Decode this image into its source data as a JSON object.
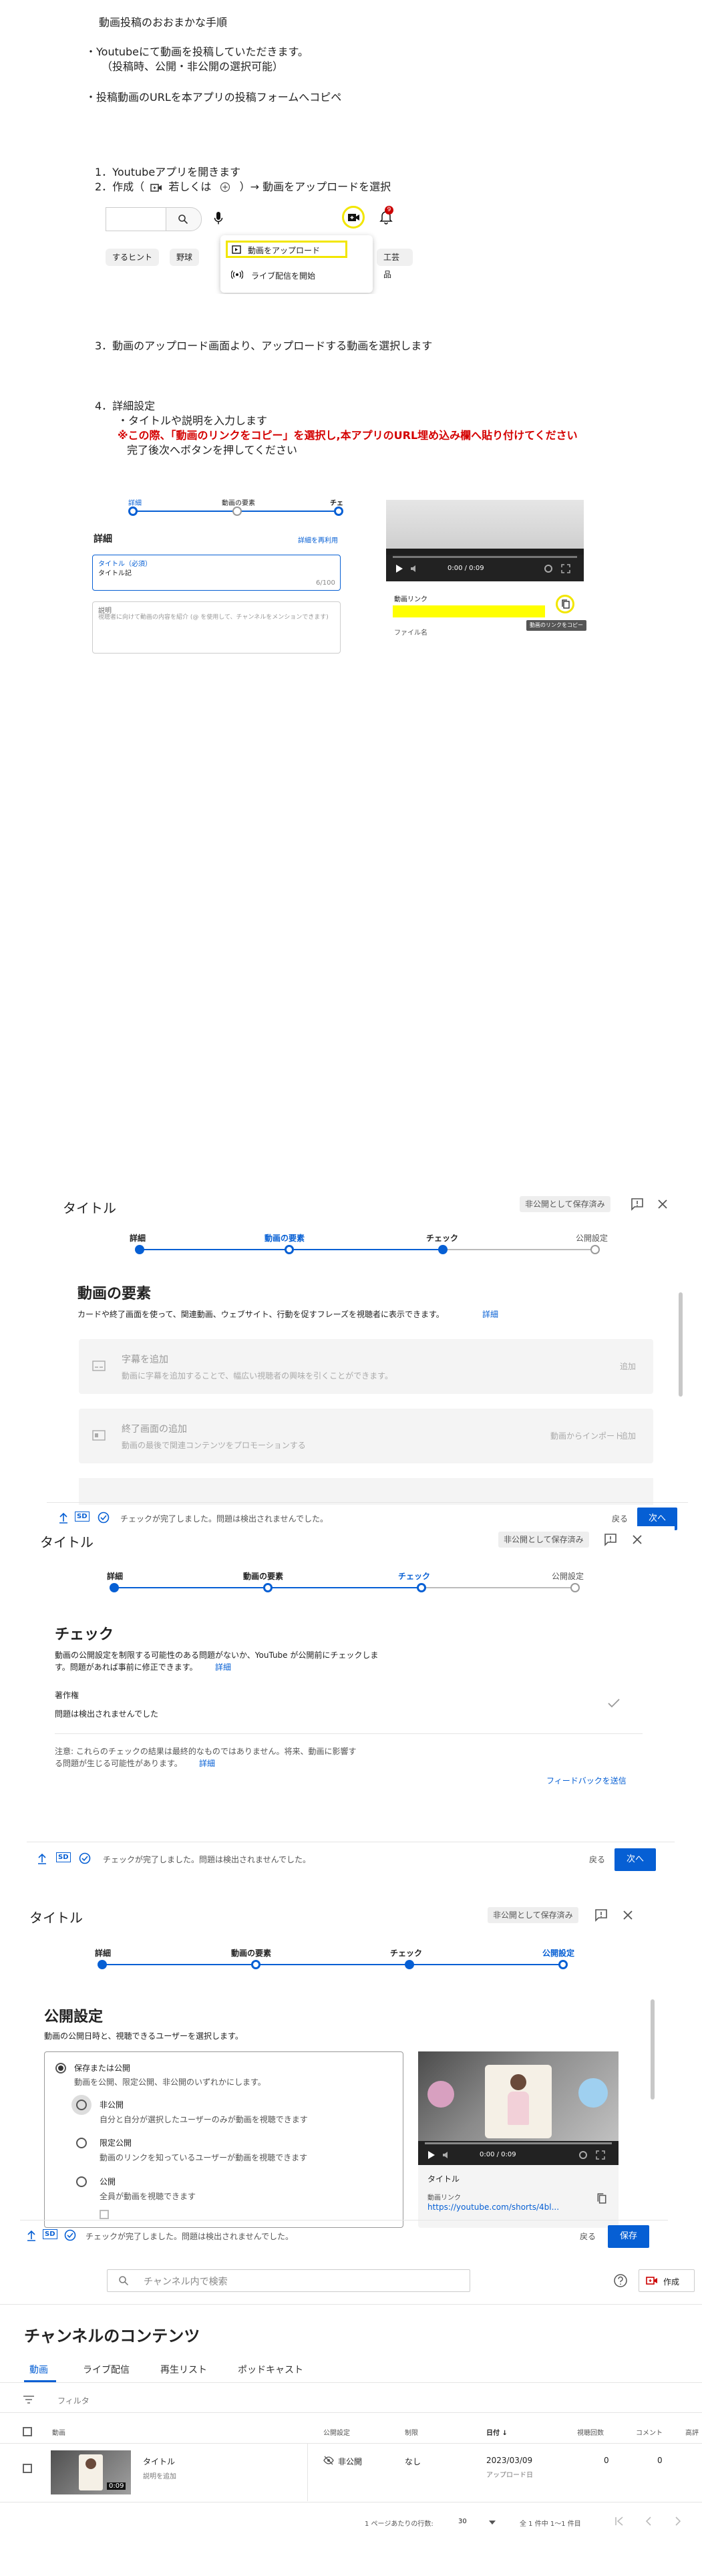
{
  "intro": {
    "heading": "動画投稿のおおまかな手順",
    "bullet1_line1": "・Youtubeにて動画を投稿していただきます。",
    "bullet1_line2": "（投稿時、公開・非公開の選択可能）",
    "bullet2": "・投稿動画のURLを本アプリの投稿フォームへコピペ"
  },
  "steps": {
    "s1": "1．Youtubeアプリを開きます",
    "s2_prefix": "2．作成（",
    "s2_mid": "若しくは",
    "s2_suffix": "）→ 動画をアップロードを選択",
    "s3": "3．動画のアップロード画面より、アップロードする動画を選択します",
    "s4": "4．詳細設定",
    "s4_a": "・タイトルや説明を入力します",
    "s4_warn": "※この際、「動画のリンクをコピー」を選択し,本アプリのURL埋め込み欄へ貼り付けてください",
    "s4_b": "完了後次へボタンを押してください"
  },
  "shot_create": {
    "menu_upload": "動画をアップロード",
    "menu_live": "ライブ配信を開始",
    "chip_hint": "するヒント",
    "chip_baseball": "野球",
    "chip_craft": "工芸品",
    "badge": "9"
  },
  "shot_details": {
    "step_details": "詳細",
    "step_elements": "動画の要素",
    "step_check": "チェ",
    "heading": "詳細",
    "reuse": "詳細を再利用",
    "title_label": "タイトル（必須）",
    "title_value": "タイトル記",
    "title_count": "6/100",
    "desc_label": "説明",
    "desc_placeholder": "視聴者に向けて動画の内容を紹介 (@ を使用して、チャンネルをメンションできます)",
    "time": "0:00 / 0:09",
    "link_label": "動画リンク",
    "file_label": "ファイル名",
    "tooltip": "動画のリンクをコピー"
  },
  "shot_elements": {
    "title": "タイトル",
    "saved_badge": "非公開として保存済み",
    "step1": "詳細",
    "step2": "動画の要素",
    "step3": "チェック",
    "step4": "公開設定",
    "heading": "動画の要素",
    "desc": "カードや終了画面を使って、関連動画、ウェブサイト、行動を促すフレーズを視聴者に表示できます。",
    "detail_link": "詳細",
    "subs_title": "字幕を追加",
    "subs_desc": "動画に字幕を追加することで、幅広い視聴者の興味を引くことができます。",
    "subs_btn": "追加",
    "end_title": "終了画面の追加",
    "end_desc": "動画の最後で関連コンテンツをプロモーションする",
    "end_import": "動画からインポート",
    "end_btn": "追加",
    "footer_sd": "SD",
    "footer_status": "チェックが完了しました。問題は検出されませんでした。",
    "back": "戻る",
    "next": "次へ"
  },
  "shot_check": {
    "title": "タイトル",
    "saved_badge": "非公開として保存済み",
    "step1": "詳細",
    "step2": "動画の要素",
    "step3": "チェック",
    "step4": "公開設定",
    "heading": "チェック",
    "desc1": "動画の公開設定を制限する可能性のある問題がないか、YouTube が公開前にチェックしま",
    "desc2": "す。問題があれば事前に修正できます。",
    "detail_link": "詳細",
    "copyright": "著作権",
    "copyright_status": "問題は検出されませんでした",
    "note1": "注意: これらのチェックの結果は最終的なものではありません。将来、動画に影響す",
    "note2": "る問題が生じる可能性があります。",
    "note_link": "詳細",
    "feedback": "フィードバックを送信",
    "footer_sd": "SD",
    "footer_status": "チェックが完了しました。問題は検出されませんでした。",
    "back": "戻る",
    "next": "次へ"
  },
  "shot_visibility": {
    "title": "タイトル",
    "saved_badge": "非公開として保存済み",
    "step1": "詳細",
    "step2": "動画の要素",
    "step3": "チェック",
    "step4": "公開設定",
    "heading": "公開設定",
    "desc": "動画の公開日時と、視聴できるユーザーを選択します。",
    "save_publish": "保存または公開",
    "save_publish_desc": "動画を公開、限定公開、非公開のいずれかにします。",
    "private": "非公開",
    "private_desc": "自分と自分が選択したユーザーのみが動画を視聴できます",
    "unlisted": "限定公開",
    "unlisted_desc": "動画のリンクを知っているユーザーが動画を視聴できます",
    "public": "公開",
    "public_desc": "全員が動画を視聴できます",
    "time": "0:00 / 0:09",
    "side_title": "タイトル",
    "link_label": "動画リンク",
    "link_url": "https://youtube.com/shorts/4bl...",
    "footer_sd": "SD",
    "footer_status": "チェックが完了しました。問題は検出されませんでした。",
    "back": "戻る",
    "save": "保存"
  },
  "shot_content": {
    "search_placeholder": "チャンネル内で検索",
    "create": "作成",
    "heading": "チャンネルのコンテンツ",
    "tabs": [
      "動画",
      "ライブ配信",
      "再生リスト",
      "ポッドキャスト"
    ],
    "filter": "フィルタ",
    "col_video": "動画",
    "col_visibility": "公開設定",
    "col_restriction": "制限",
    "col_date": "日付 ↓",
    "col_views": "視聴回数",
    "col_comments": "コメント",
    "col_rating": "高評",
    "row_title": "タイトル",
    "row_desc": "説明を追加",
    "row_duration": "0:09",
    "row_visibility": "非公開",
    "row_restriction": "なし",
    "row_date": "2023/03/09",
    "row_date_sub": "アップロード日",
    "row_views": "0",
    "row_comments": "0",
    "rows_per_page_label": "1 ページあたりの行数:",
    "rows_per_page": "30",
    "range": "全 1 件中 1〜1 件目"
  }
}
